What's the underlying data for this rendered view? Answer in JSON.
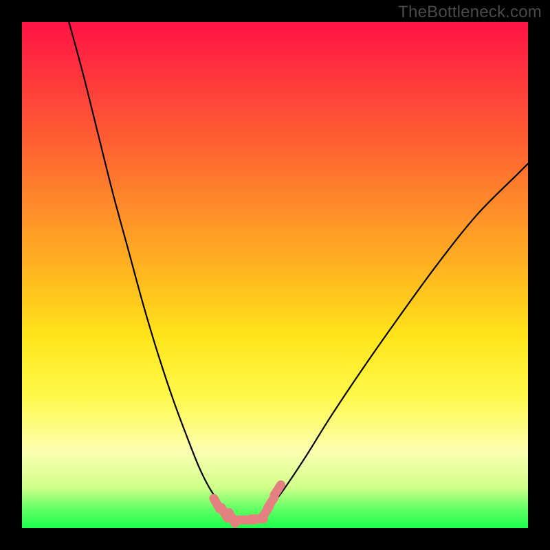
{
  "watermark": "TheBottleneck.com",
  "colors": {
    "background": "#000000",
    "curve": "#000000",
    "marker_fill": "#e58080",
    "marker_stroke": "#d86f6f"
  },
  "chart_data": {
    "type": "line",
    "title": "",
    "xlabel": "",
    "ylabel": "",
    "xlim": [
      0,
      100
    ],
    "ylim": [
      0,
      100
    ],
    "note": "Two unlabeled curves over a red→green vertical gradient. No axis ticks or numeric labels are visible, so x/y values are geometric estimates on a 0–100 canvas scale (y=0 at bottom).",
    "series": [
      {
        "name": "left-curve",
        "x": [
          9,
          12,
          15,
          18,
          21,
          24,
          27,
          30,
          33,
          35,
          37,
          39,
          40.5,
          42
        ],
        "y": [
          101,
          90,
          78,
          66,
          55,
          44,
          34,
          25,
          17,
          12,
          8,
          5,
          3,
          2
        ]
      },
      {
        "name": "right-curve",
        "x": [
          47,
          49,
          52,
          56,
          61,
          67,
          74,
          82,
          90,
          98,
          100
        ],
        "y": [
          2,
          4,
          8,
          14,
          22,
          31,
          41,
          52,
          62,
          70,
          72
        ]
      }
    ],
    "markers": {
      "name": "salmon-markers",
      "note": "Short thick salmon-colored dashed segments near the trough of the curves.",
      "points": [
        {
          "x": 38.5,
          "y": 4.8
        },
        {
          "x": 40.0,
          "y": 3.0
        },
        {
          "x": 41.5,
          "y": 2.0
        },
        {
          "x": 43.0,
          "y": 1.6
        },
        {
          "x": 44.8,
          "y": 1.6
        },
        {
          "x": 46.5,
          "y": 1.8
        },
        {
          "x": 48.2,
          "y": 3.2
        },
        {
          "x": 49.2,
          "y": 5.0
        },
        {
          "x": 50.5,
          "y": 7.5
        }
      ]
    }
  }
}
